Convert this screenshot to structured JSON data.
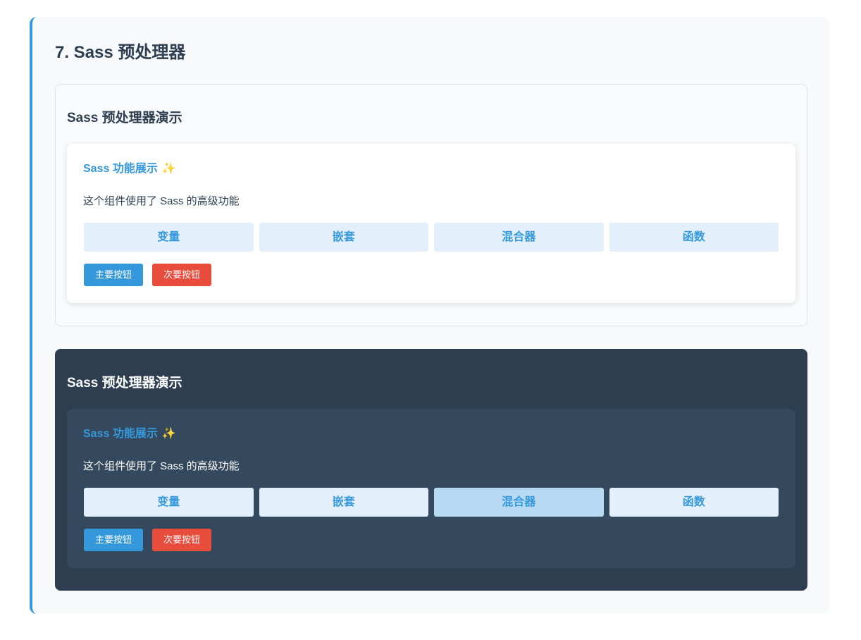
{
  "section": {
    "title": "7. Sass 预处理器"
  },
  "demos": [
    {
      "theme": "light",
      "title": "Sass 预处理器演示",
      "card": {
        "title": "Sass 功能展示",
        "sparkle_icon": "✨",
        "description": "这个组件使用了 Sass 的高级功能",
        "features": [
          "变量",
          "嵌套",
          "混合器",
          "函数"
        ],
        "primary_button": "主要按钮",
        "secondary_button": "次要按钮"
      }
    },
    {
      "theme": "dark",
      "title": "Sass 预处理器演示",
      "card": {
        "title": "Sass 功能展示",
        "sparkle_icon": "✨",
        "description": "这个组件使用了 Sass 的高级功能",
        "features": [
          "变量",
          "嵌套",
          "混合器",
          "函数"
        ],
        "active_feature": "混合器",
        "primary_button": "主要按钮",
        "secondary_button": "次要按钮"
      }
    }
  ],
  "colors": {
    "accent": "#3498db",
    "danger": "#e74c3c",
    "dark_bg": "#2c3e50",
    "dark_card": "#34495e",
    "feature_bg": "#e3f0fb",
    "feature_active_bg": "#b7d9f2"
  }
}
